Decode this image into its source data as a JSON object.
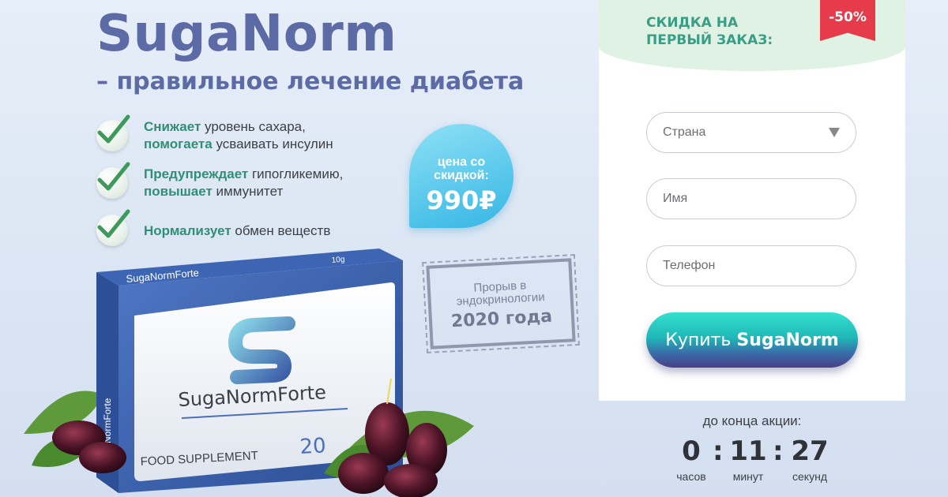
{
  "hero": {
    "title": "SugaNorm",
    "subtitle": "– правильное лечение диабета"
  },
  "features": [
    {
      "b1": "Снижает",
      "t1": " уровень сахара,",
      "b2": "помогаета",
      "t2": " усваивать инсулин"
    },
    {
      "b1": "Предупреждает",
      "t1": " гипогликемию,",
      "b2": "повышает",
      "t2": " иммунитет"
    },
    {
      "b1": "Нормализует",
      "t1": " обмен веществ",
      "b2": "",
      "t2": ""
    }
  ],
  "price_badge": {
    "label_line1": "цена со",
    "label_line2": "скидкой:",
    "value": "990₽"
  },
  "stamp": {
    "line1": "Прорыв в",
    "line2": "эндокринологии",
    "line3": "2020 года"
  },
  "product": {
    "box_top": "SugaNormForte",
    "box_side": "SugaNormForte",
    "box_weight": "10g",
    "brand": "SugaNormForte",
    "supplement": "FOOD SUPPLEMENT",
    "count": "20"
  },
  "form": {
    "heading_line1": "СКИДКА НА",
    "heading_line2": "ПЕРВЫЙ ЗАКАЗ:",
    "discount": "-50%",
    "country_placeholder": "Страна",
    "name_placeholder": "Имя",
    "phone_placeholder": "Телефон",
    "buy_prefix": "Купить ",
    "buy_brand": "SugaNorm"
  },
  "timer": {
    "label": "до конца акции:",
    "hours": "0",
    "minutes": "11",
    "seconds": "27",
    "hours_caption": "часов",
    "minutes_caption": "минут",
    "seconds_caption": "секунд",
    "separator": ":"
  },
  "colors": {
    "title": "#5c6aa6",
    "accent_green": "#2f8f76",
    "discount_red": "#e53b4a",
    "badge_blue": "#34b6e4"
  }
}
